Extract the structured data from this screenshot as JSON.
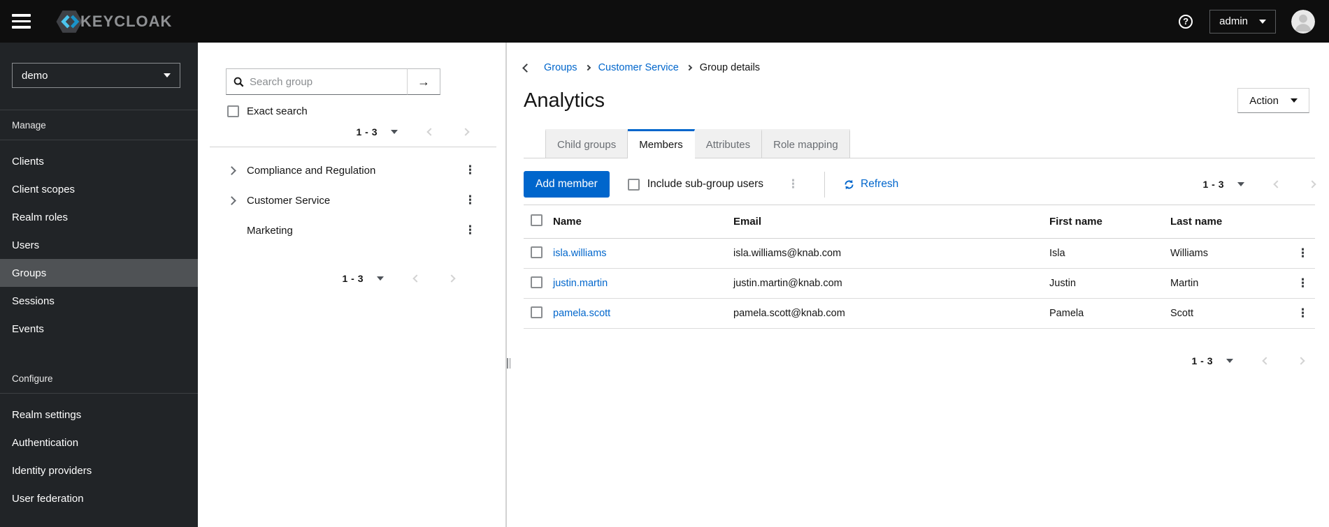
{
  "colors": {
    "accent": "#0066cc",
    "masthead_bg": "#0e0e0e",
    "sidebar_bg": "#212427",
    "sidebar_active_bg": "#4f5255",
    "tab_inactive_bg": "#f0f0f0",
    "border": "#d2d2d2",
    "logo_cyan": "#4cc5ee",
    "logo_blue": "#1a93c9"
  },
  "icons": {
    "help": "?",
    "kebab": "⋮",
    "search_submit_arrow": "→"
  },
  "masthead": {
    "brand": "KEYCLOAK",
    "user": "admin"
  },
  "sidebar": {
    "realm": "demo",
    "manage": {
      "label": "Manage",
      "items": [
        {
          "label": "Clients"
        },
        {
          "label": "Client scopes"
        },
        {
          "label": "Realm roles"
        },
        {
          "label": "Users"
        },
        {
          "label": "Groups"
        },
        {
          "label": "Sessions"
        },
        {
          "label": "Events"
        }
      ],
      "active_item": "Groups"
    },
    "configure": {
      "label": "Configure",
      "items": [
        {
          "label": "Realm settings"
        },
        {
          "label": "Authentication"
        },
        {
          "label": "Identity providers"
        },
        {
          "label": "User federation"
        }
      ]
    }
  },
  "tree_panel": {
    "search_placeholder": "Search group",
    "exact_search_label": "Exact search",
    "pagination_top": "1 - 3",
    "pagination_bottom": "1 - 3",
    "groups": [
      {
        "name": "Compliance and Regulation",
        "expandable": true
      },
      {
        "name": "Customer Service",
        "expandable": true
      },
      {
        "name": "Marketing",
        "expandable": false
      }
    ]
  },
  "main": {
    "breadcrumb": {
      "items": [
        "Groups",
        "Customer Service",
        "Group details"
      ]
    },
    "title": "Analytics",
    "action_button": "Action",
    "tabs": [
      {
        "label": "Child groups",
        "active": false
      },
      {
        "label": "Members",
        "active": true
      },
      {
        "label": "Attributes",
        "active": false
      },
      {
        "label": "Role mapping",
        "active": false
      }
    ],
    "toolbar": {
      "add_member": "Add member",
      "include_subgroups": "Include sub-group users",
      "refresh": "Refresh",
      "pagination": "1 - 3"
    },
    "table": {
      "headers": [
        "Name",
        "Email",
        "First name",
        "Last name"
      ],
      "rows": [
        {
          "name": "isla.williams",
          "email": "isla.williams@knab.com",
          "first": "Isla",
          "last": "Williams"
        },
        {
          "name": "justin.martin",
          "email": "justin.martin@knab.com",
          "first": "Justin",
          "last": "Martin"
        },
        {
          "name": "pamela.scott",
          "email": "pamela.scott@knab.com",
          "first": "Pamela",
          "last": "Scott"
        }
      ]
    },
    "pagination_bottom": "1 - 3"
  }
}
